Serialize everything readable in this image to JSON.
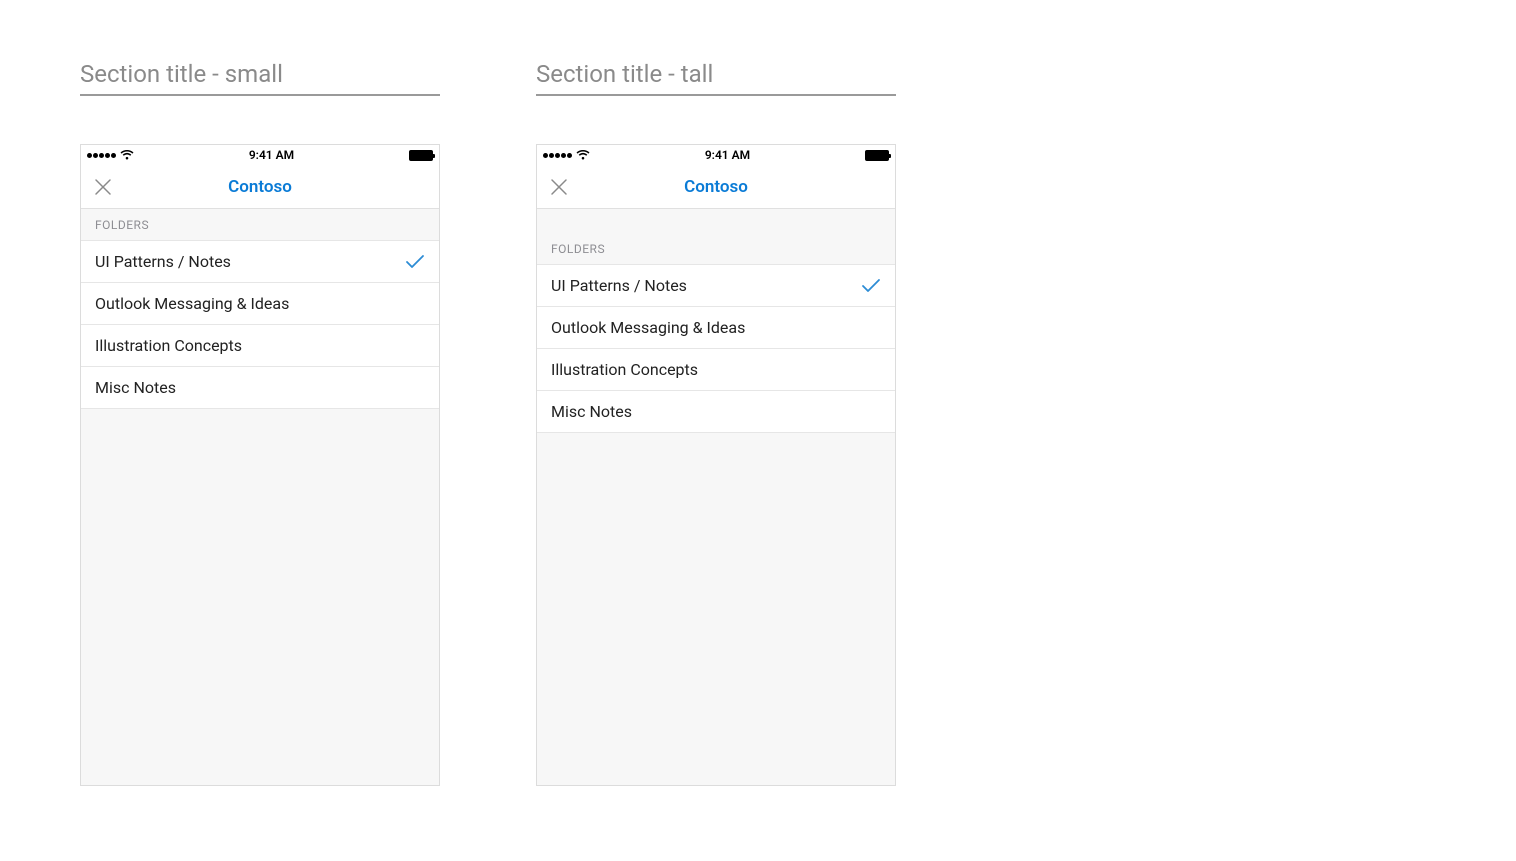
{
  "examples": [
    {
      "title": "Section title - small",
      "variant": "small"
    },
    {
      "title": "Section title - tall",
      "variant": "tall"
    }
  ],
  "status": {
    "time": "9:41 AM"
  },
  "nav": {
    "title": "Contoso"
  },
  "section": {
    "label": "FOLDERS"
  },
  "folders": [
    {
      "label": "UI Patterns / Notes",
      "selected": true
    },
    {
      "label": "Outlook Messaging & Ideas",
      "selected": false
    },
    {
      "label": "Illustration Concepts",
      "selected": false
    },
    {
      "label": "Misc Notes",
      "selected": false
    }
  ],
  "colors": {
    "accent": "#0a7bd6",
    "section_bg": "#f7f7f7",
    "border": "#e6e6e6"
  }
}
